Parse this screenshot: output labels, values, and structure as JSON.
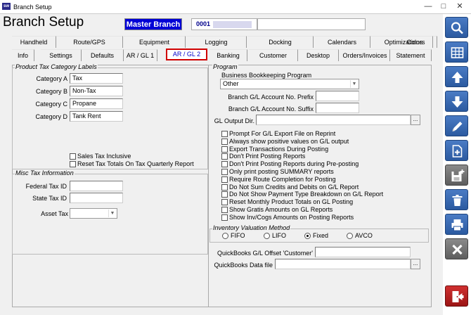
{
  "window": {
    "title": "Branch Setup"
  },
  "header": {
    "heading": "Branch Setup",
    "branch_name": "Master Branch",
    "branch_code": "0001"
  },
  "tabs_row1": [
    "Handheld",
    "Route/GPS",
    "Equipment",
    "Logging",
    "Docking",
    "Calendars",
    "Optimizations",
    "Colors"
  ],
  "tabs_row2": [
    "Info",
    "Settings",
    "Defaults",
    "AR / GL 1",
    "AR / GL 2",
    "Banking",
    "Customer",
    "Desktop",
    "Orders/Invoices",
    "Statement"
  ],
  "active_tab": "AR / GL 2",
  "product_tax": {
    "title": "Product Tax Category Labels",
    "rows": [
      {
        "label": "Category A",
        "value": "Tax"
      },
      {
        "label": "Category B",
        "value": "Non-Tax"
      },
      {
        "label": "Category C",
        "value": "Propane"
      },
      {
        "label": "Category D",
        "value": "Tank Rent"
      }
    ],
    "sales_tax_inclusive": "Sales Tax Inclusive",
    "reset_tax_totals": "Reset Tax Totals On Tax Quarterly Report"
  },
  "misc_tax": {
    "title": "Misc Tax Information",
    "federal_label": "Federal Tax ID",
    "state_label": "State Tax ID",
    "asset_label": "Asset Tax",
    "federal_value": "",
    "state_value": "",
    "asset_value": ""
  },
  "program": {
    "title": "Program",
    "bookkeeping_label": "Business Bookkeeping Program",
    "bookkeeping_value": "Other",
    "prefix_label": "Branch G/L Account No. Prefix",
    "suffix_label": "Branch G/L Account No. Suffix",
    "output_dir_label": "GL Output Dir.",
    "ellipsis": "...",
    "options": [
      "Prompt For G/L Export File on Reprint",
      "Always show positive values on G/L output",
      "Export Transactions During Posting",
      "Don't Print Posting Reports",
      "Don't Print Posting Reports during Pre-posting",
      "Only print posting SUMMARY reports",
      "Require Route Completion for Posting",
      "Do Not Sum Credits and Debits on G/L Report",
      "Do Not Show Payment Type Breakdown on G/L Report",
      "Reset Monthly Product Totals on GL Posting",
      "Show Gratis Amounts on GL Reports",
      "Show Inv/Cogs Amounts on Posting Reports"
    ]
  },
  "inventory": {
    "title": "Inventory Valuation Method",
    "methods": [
      "FIFO",
      "LIFO",
      "Fixed",
      "AVCO"
    ],
    "selected": "Fixed"
  },
  "quickbooks": {
    "offset_label": "QuickBooks G/L Offset 'Customer'",
    "data_file_label": "QuickBooks Data file",
    "offset_value": "",
    "data_file_value": ""
  },
  "sidebar_icons": [
    "search-icon",
    "grid-icon",
    "arrow-up-icon",
    "arrow-down-icon",
    "pencil-icon",
    "new-document-icon",
    "save-new-icon",
    "trash-icon",
    "printer-icon",
    "close-icon",
    "exit-icon"
  ]
}
